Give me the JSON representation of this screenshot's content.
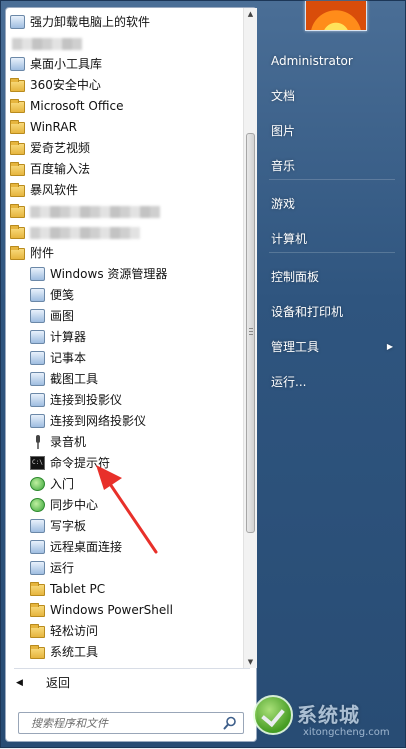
{
  "programs": {
    "items": [
      {
        "label": "强力卸载电脑上的软件",
        "icon": "app-icon",
        "level": 0
      },
      {
        "label": "",
        "icon": "blurred-icon",
        "level": 0,
        "blurred": true
      },
      {
        "label": "桌面小工具库",
        "icon": "gadget-icon",
        "level": 0
      },
      {
        "label": "360安全中心",
        "icon": "folder-icon",
        "level": 0
      },
      {
        "label": "Microsoft Office",
        "icon": "folder-icon",
        "level": 0
      },
      {
        "label": "WinRAR",
        "icon": "folder-icon",
        "level": 0
      },
      {
        "label": "爱奇艺视频",
        "icon": "folder-icon",
        "level": 0
      },
      {
        "label": "百度输入法",
        "icon": "folder-icon",
        "level": 0
      },
      {
        "label": "暴风软件",
        "icon": "folder-icon",
        "level": 0
      },
      {
        "label": "",
        "icon": "folder-icon",
        "level": 0,
        "blurred": true
      },
      {
        "label": "",
        "icon": "folder-icon",
        "level": 0,
        "blurred": true
      },
      {
        "label": "附件",
        "icon": "folder-icon",
        "level": 0
      },
      {
        "label": "Windows 资源管理器",
        "icon": "explorer-icon",
        "level": 1
      },
      {
        "label": "便笺",
        "icon": "sticky-notes-icon",
        "level": 1
      },
      {
        "label": "画图",
        "icon": "paint-icon",
        "level": 1
      },
      {
        "label": "计算器",
        "icon": "calculator-icon",
        "level": 1
      },
      {
        "label": "记事本",
        "icon": "notepad-icon",
        "level": 1
      },
      {
        "label": "截图工具",
        "icon": "snipping-tool-icon",
        "level": 1
      },
      {
        "label": "连接到投影仪",
        "icon": "projector-icon",
        "level": 1
      },
      {
        "label": "连接到网络投影仪",
        "icon": "network-projector-icon",
        "level": 1
      },
      {
        "label": "录音机",
        "icon": "microphone-icon",
        "level": 1
      },
      {
        "label": "命令提示符",
        "icon": "command-prompt-icon",
        "level": 1
      },
      {
        "label": "入门",
        "icon": "getting-started-icon",
        "level": 1
      },
      {
        "label": "同步中心",
        "icon": "sync-center-icon",
        "level": 1
      },
      {
        "label": "写字板",
        "icon": "wordpad-icon",
        "level": 1
      },
      {
        "label": "远程桌面连接",
        "icon": "remote-desktop-icon",
        "level": 1
      },
      {
        "label": "运行",
        "icon": "run-icon",
        "level": 1
      },
      {
        "label": "Tablet PC",
        "icon": "folder-icon",
        "level": 1
      },
      {
        "label": "Windows PowerShell",
        "icon": "folder-icon",
        "level": 1
      },
      {
        "label": "轻松访问",
        "icon": "folder-icon",
        "level": 1
      },
      {
        "label": "系统工具",
        "icon": "folder-icon",
        "level": 1
      }
    ]
  },
  "back_label": "返回",
  "search": {
    "placeholder": "搜索程序和文件"
  },
  "right_menu": {
    "items": [
      {
        "label": "Administrator"
      },
      {
        "label": "文档"
      },
      {
        "label": "图片"
      },
      {
        "label": "音乐"
      },
      {
        "label": "游戏"
      },
      {
        "label": "计算机"
      },
      {
        "label": "控制面板"
      },
      {
        "label": "设备和打印机"
      },
      {
        "label": "管理工具",
        "submenu": true
      },
      {
        "label": "运行..."
      }
    ]
  },
  "watermark": {
    "text": "系统城",
    "url": "xitongcheng.com"
  },
  "colors": {
    "accent": "#2f557f",
    "annotation_arrow": "#e8302a"
  }
}
